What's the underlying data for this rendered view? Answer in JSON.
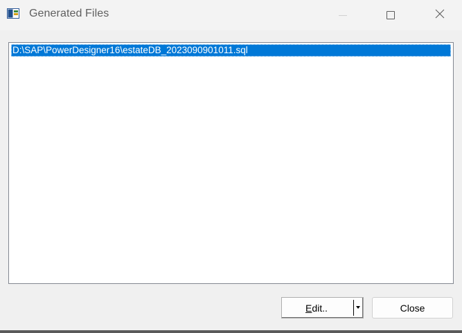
{
  "window": {
    "title": "Generated Files",
    "icons": {
      "app": "app-window-icon",
      "minimize": "minimize-icon",
      "maximize": "maximize-icon",
      "close": "close-icon"
    }
  },
  "file_list": {
    "items": [
      {
        "path": "D:\\SAP\\PowerDesigner16\\estateDB_2023090901011.sql",
        "selected": true
      }
    ]
  },
  "buttons": {
    "edit_prefix": "E",
    "edit_rest": "dit..",
    "close_label": "Close"
  },
  "colors": {
    "selection": "#0078d7",
    "window_bg": "#f0f0f0",
    "list_bg": "#ffffff"
  }
}
